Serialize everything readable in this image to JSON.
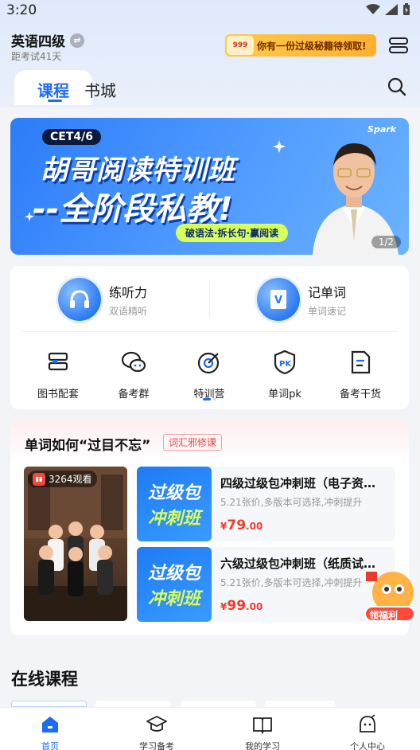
{
  "status_bar": {
    "time": "3:20"
  },
  "header": {
    "exam_name": "英语四级",
    "countdown": "距考试41天",
    "promo_text": "你有一份过级秘籍待领取!",
    "promo_icon_text": "999"
  },
  "tabs": [
    {
      "label": "课程",
      "active": true
    },
    {
      "label": "书城",
      "active": false
    }
  ],
  "banner": {
    "tag": "CET4/6",
    "logo": "Spark",
    "line1": "胡哥阅读特训班",
    "line2": "--全阶段私教!",
    "subtitle": "破语法·拆长句·赢阅读",
    "page": "1/2"
  },
  "features": {
    "big": [
      {
        "title": "练听力",
        "subtitle": "双语精听"
      },
      {
        "title": "记单词",
        "subtitle": "单词速记"
      }
    ],
    "small": [
      {
        "label": "图书配套",
        "icon": "book-stack-icon"
      },
      {
        "label": "备考群",
        "icon": "chat-icon"
      },
      {
        "label": "特训营",
        "icon": "target-icon"
      },
      {
        "label": "单词pk",
        "icon": "pk-shield-icon"
      },
      {
        "label": "备考干货",
        "icon": "document-icon"
      }
    ]
  },
  "promo": {
    "title": "单词如何“过目不忘”",
    "badge": "词汇邪修课",
    "views": "3264观看",
    "courses": [
      {
        "thumb_line1": "过级包",
        "thumb_line2": "冲刺班",
        "name": "四级过级包冲刺班（电子资…",
        "desc": "5.21张价,多版本可选择,冲刺提升",
        "price_symbol": "¥",
        "price_int": "79",
        "price_dec": ".00"
      },
      {
        "thumb_line1": "过级包",
        "thumb_line2": "冲刺班",
        "name": "六级过级包冲刺班（纸质试…",
        "desc": "5.21张价,多版本可选择,冲刺提升",
        "price_symbol": "¥",
        "price_int": "99",
        "price_dec": ".00"
      }
    ],
    "gift_label": "领福利"
  },
  "online_courses": {
    "title": "在线课程"
  },
  "bottom_nav": [
    {
      "label": "首页",
      "active": true,
      "icon": "home-icon"
    },
    {
      "label": "学习备考",
      "active": false,
      "icon": "graduation-cap-icon"
    },
    {
      "label": "我的学习",
      "active": false,
      "icon": "open-book-icon"
    },
    {
      "label": "个人中心",
      "active": false,
      "icon": "profile-face-icon"
    }
  ],
  "colors": {
    "accent": "#1e6cf2",
    "price": "#f03b2e",
    "badge": "#e04848"
  }
}
